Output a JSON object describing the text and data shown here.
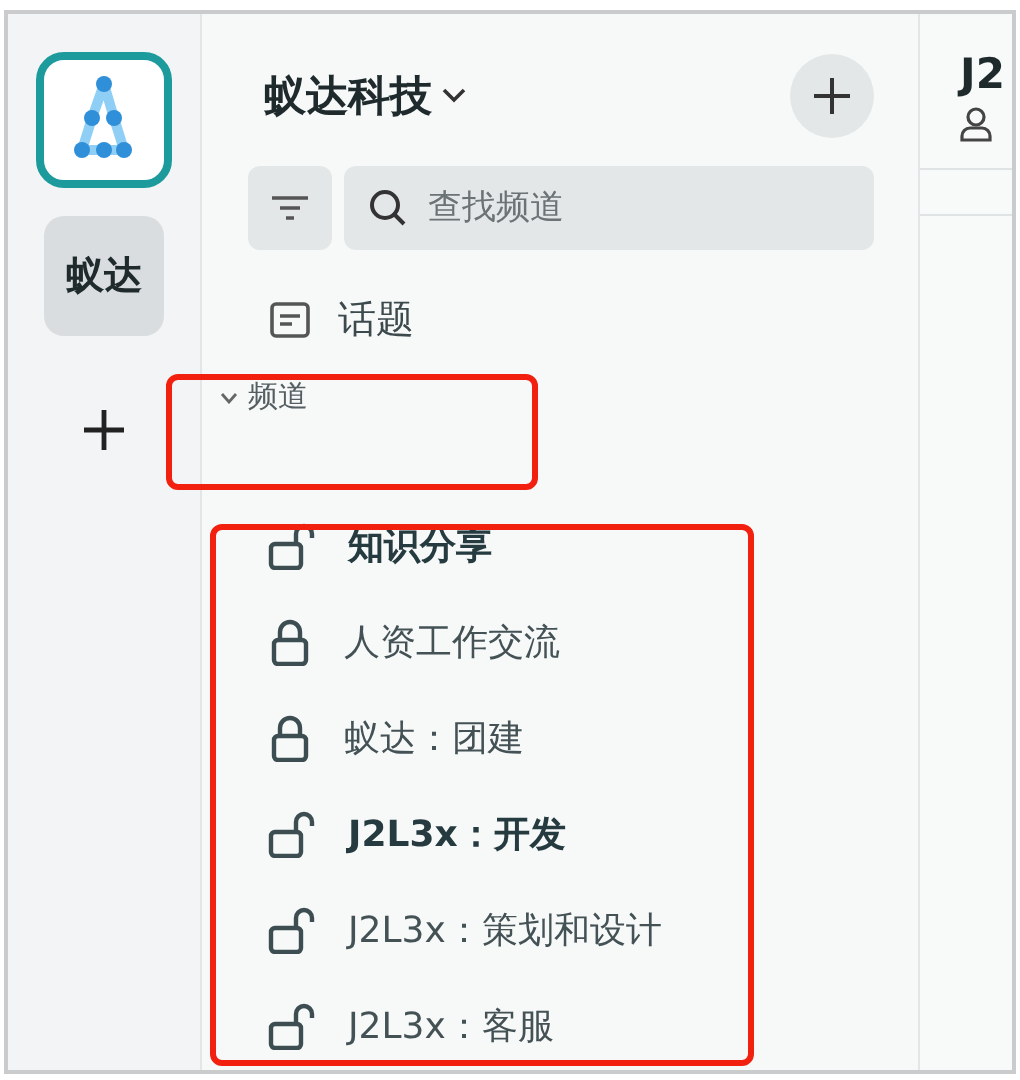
{
  "workspace_rail": {
    "workspaces": [
      {
        "label": "蚁达",
        "selected": true
      }
    ]
  },
  "sidebar": {
    "title": "蚁达科技",
    "search": {
      "placeholder": "查找频道"
    },
    "topics": {
      "label": "话题"
    },
    "section": {
      "label": "频道",
      "expanded": true
    },
    "channels": [
      {
        "name": "知识分享",
        "locked": false,
        "unread": true
      },
      {
        "name": "人资工作交流",
        "locked": true,
        "unread": false
      },
      {
        "name": "蚁达：团建",
        "locked": true,
        "unread": false
      },
      {
        "name": "J2L3x：开发",
        "locked": false,
        "unread": true
      },
      {
        "name": "J2L3x：策划和设计",
        "locked": false,
        "unread": false
      },
      {
        "name": "J2L3x：客服",
        "locked": false,
        "unread": false
      }
    ]
  },
  "main": {
    "title": "J2"
  }
}
